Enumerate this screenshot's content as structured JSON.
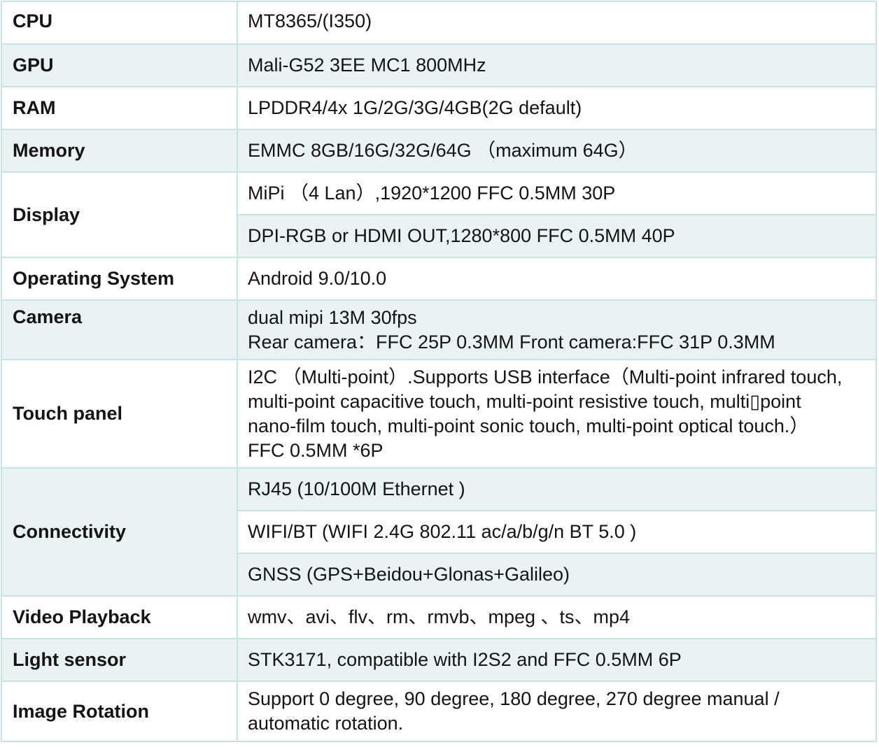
{
  "rows": {
    "cpu": {
      "label": "CPU",
      "value": "MT8365/(I350)"
    },
    "gpu": {
      "label": "GPU",
      "value": "Mali-G52 3EE MC1 800MHz"
    },
    "ram": {
      "label": "RAM",
      "value": "LPDDR4/4x 1G/2G/3G/4GB(2G default)"
    },
    "memory": {
      "label": "Memory",
      "value": "EMMC 8GB/16G/32G/64G （maximum 64G）"
    },
    "display": {
      "label": "Display",
      "values": [
        "MiPi （4 Lan）,1920*1200 FFC 0.5MM 30P",
        "DPI-RGB or HDMI OUT,1280*800 FFC 0.5MM 40P"
      ]
    },
    "os": {
      "label": "Operating System",
      "value": "Android 9.0/10.0"
    },
    "camera": {
      "label": "Camera",
      "lines": [
        "dual mipi 13M 30fps",
        "Rear camera：FFC 25P 0.3MM Front camera:FFC 31P 0.3MM"
      ]
    },
    "touch": {
      "label": "Touch panel",
      "lines": [
        "I2C （Multi-point）.Supports USB interface（Multi-point infrared touch,",
        "multi-point capacitive touch, multi-point resistive touch, multi▯point",
        "nano-film touch, multi-point sonic touch, multi-point optical touch.）",
        "FFC 0.5MM *6P"
      ]
    },
    "connectivity": {
      "label": "Connectivity",
      "values": [
        "RJ45 (10/100M Ethernet )",
        "WIFI/BT (WIFI 2.4G 802.11 ac/a/b/g/n BT 5.0 )",
        "GNSS (GPS+Beidou+Glonas+Galileo)"
      ]
    },
    "video": {
      "label": "Video Playback",
      "value": "wmv、avi、flv、rm、rmvb、mpeg 、ts、mp4"
    },
    "light": {
      "label": "Light sensor",
      "value": "STK3171, compatible with I2S2 and FFC 0.5MM 6P"
    },
    "rotation": {
      "label": "Image Rotation",
      "lines": [
        "Support 0 degree, 90 degree, 180 degree, 270 degree manual /",
        "automatic rotation."
      ]
    }
  },
  "colors": {
    "row_white": "#ffffff",
    "row_teal": "#e9f3f3",
    "border": "#c9e3e4",
    "text": "#141414"
  }
}
